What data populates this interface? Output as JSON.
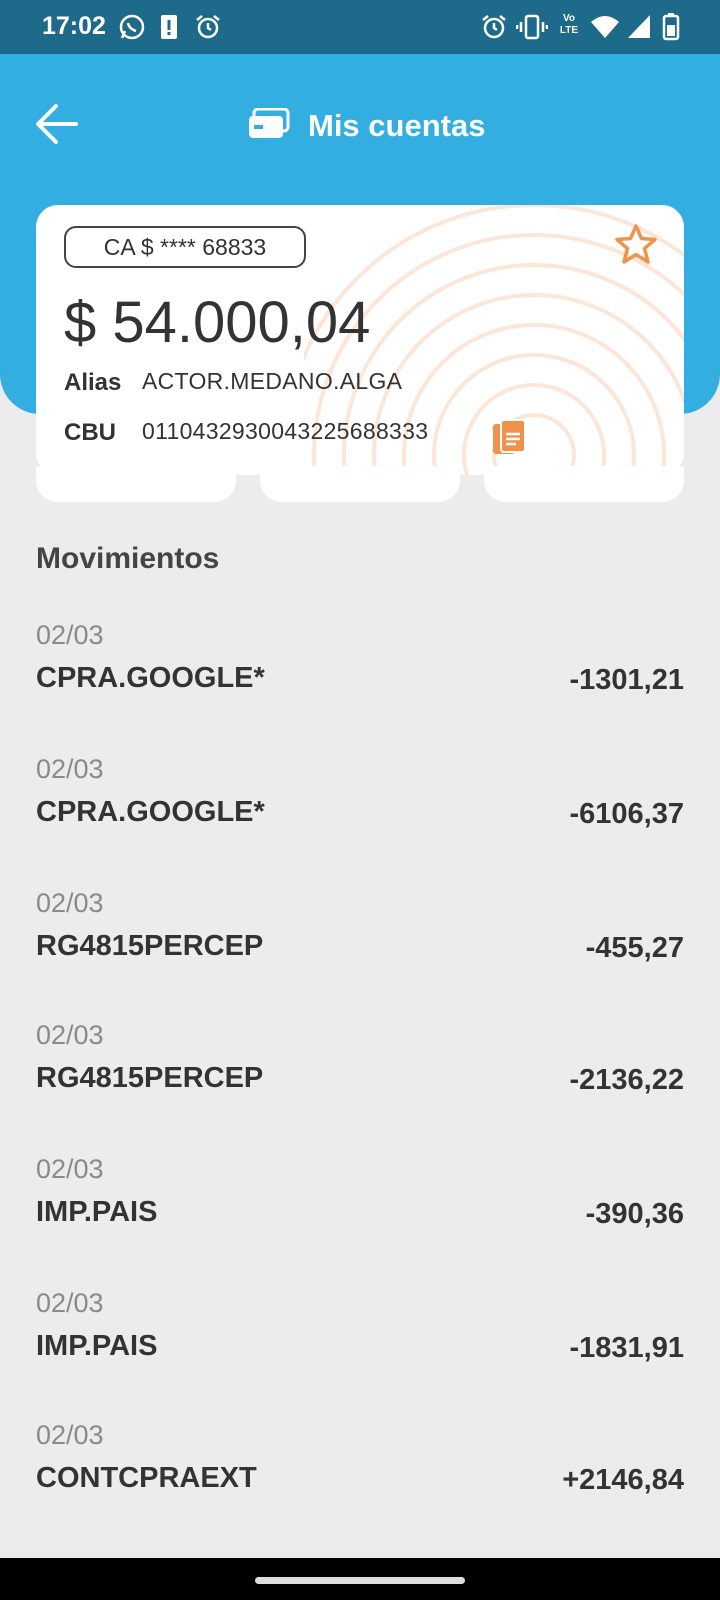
{
  "status_bar": {
    "time": "17:02",
    "network_label": "Vo LTE"
  },
  "header": {
    "title": "Mis cuentas"
  },
  "account": {
    "chip": "CA $ **** 68833",
    "balance": "$ 54.000,04",
    "alias_label": "Alias",
    "alias_value": "ACTOR.MEDANO.ALGA",
    "cbu_label": "CBU",
    "cbu_value": "0110432930043225688333"
  },
  "movements": {
    "title": "Movimientos",
    "items": [
      {
        "date": "02/03",
        "description": "CPRA.GOOGLE*",
        "amount": "-1301,21"
      },
      {
        "date": "02/03",
        "description": "CPRA.GOOGLE*",
        "amount": "-6106,37"
      },
      {
        "date": "02/03",
        "description": "RG4815PERCEP",
        "amount": "-455,27"
      },
      {
        "date": "02/03",
        "description": "RG4815PERCEP",
        "amount": "-2136,22"
      },
      {
        "date": "02/03",
        "description": "IMP.PAIS",
        "amount": "-390,36"
      },
      {
        "date": "02/03",
        "description": "IMP.PAIS",
        "amount": "-1831,91"
      },
      {
        "date": "02/03",
        "description": "CONTCPRAEXT",
        "amount": "+2146,84"
      }
    ]
  },
  "colors": {
    "header": "#33aee0",
    "status_bar": "#1e6a8a",
    "accent": "#f0934a",
    "background": "#ececec"
  },
  "icons": [
    "whatsapp-icon",
    "battery-alert-icon",
    "alarm-icon",
    "vibrate-icon",
    "wifi-icon",
    "signal-icon",
    "battery-icon",
    "back-arrow-icon",
    "card-icon",
    "star-icon",
    "copy-icon"
  ]
}
